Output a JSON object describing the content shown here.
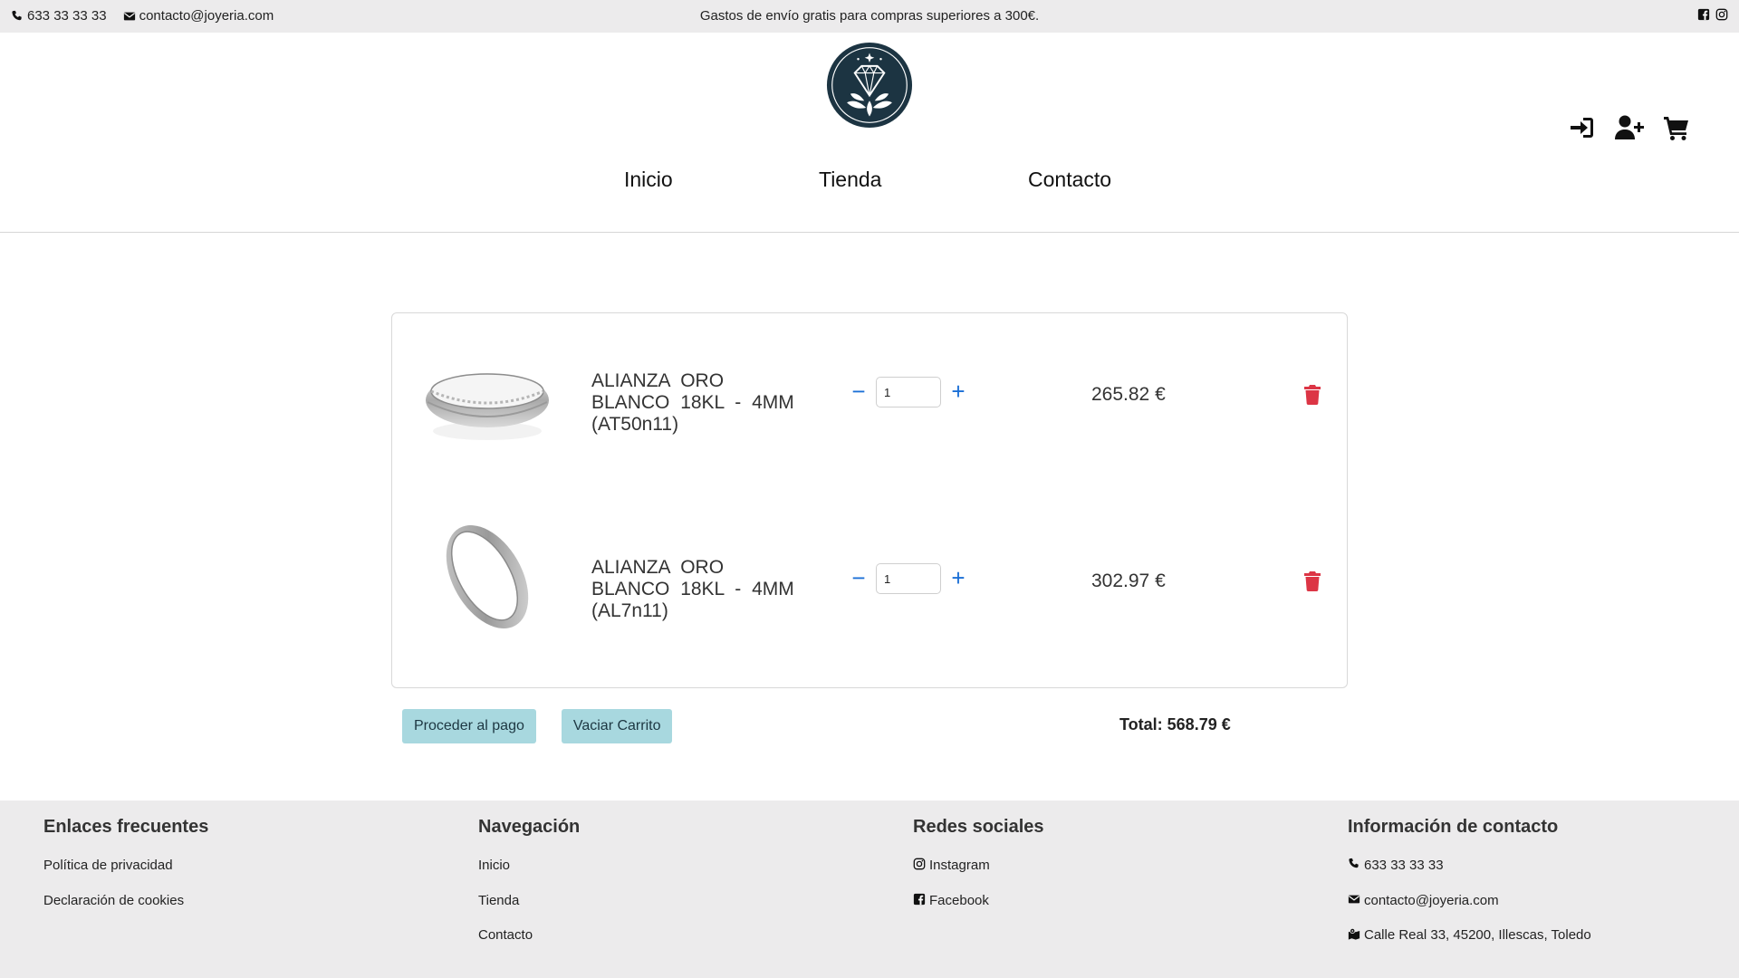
{
  "topbar": {
    "phone": "633 33 33 33",
    "email": "contacto@joyeria.com",
    "promo": "Gastos de envío gratis para compras superiores a 300€.",
    "social_icons": [
      "facebook-icon",
      "instagram-icon"
    ]
  },
  "header": {
    "logo_icon": "diamond-logo",
    "nav": [
      "Inicio",
      "Tienda",
      "Contacto"
    ],
    "action_icons": [
      "login-icon",
      "register-user-icon",
      "cart-icon"
    ]
  },
  "cart": {
    "items": [
      {
        "name": "ALIANZA ORO BLANCO 18KL - 4MM (AT50n11)",
        "quantity": "1",
        "price": "265.82 €"
      },
      {
        "name": "ALIANZA ORO BLANCO 18KL - 4MM (AL7n11)",
        "quantity": "1",
        "price": "302.97 €"
      }
    ],
    "checkout_label": "Proceder al pago",
    "empty_label": "Vaciar Carrito",
    "total_label": "Total: 568.79 €",
    "colors": {
      "accent_button": "#a8d8df",
      "qty_controls": "#1b6fd6",
      "delete": "#dc3545"
    }
  },
  "footer": {
    "columns": [
      {
        "title": "Enlaces frecuentes",
        "items": [
          "Política de privacidad",
          "Declaración de cookies"
        ]
      },
      {
        "title": "Navegación",
        "items": [
          "Inicio",
          "Tienda",
          "Contacto"
        ]
      },
      {
        "title": "Redes sociales",
        "items": [
          "Instagram",
          "Facebook"
        ]
      },
      {
        "title": "Información de contacto",
        "items": [
          "633 33 33 33",
          "contacto@joyeria.com",
          "Calle Real 33, 45200, Illescas, Toledo"
        ]
      }
    ]
  }
}
